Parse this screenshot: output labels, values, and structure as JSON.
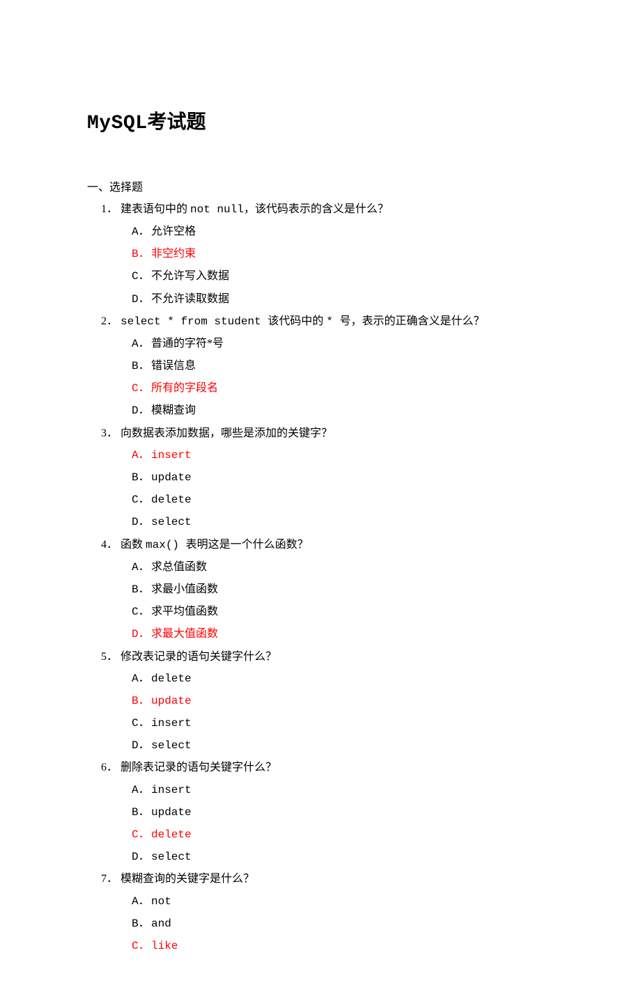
{
  "title_en": "MySQL",
  "title_cn": "考试题",
  "section_header": "一、选择题",
  "questions": [
    {
      "num": "1．",
      "parts": [
        {
          "t": "建表语句中的 ",
          "mono": false
        },
        {
          "t": "not null",
          "mono": true
        },
        {
          "t": "，该代码表示的含义是什么？",
          "mono": false
        }
      ],
      "options": [
        {
          "label": "A．",
          "text": "允许空格",
          "highlight": false,
          "mono": false
        },
        {
          "label": "B．",
          "text": "非空约束",
          "highlight": true,
          "mono": false
        },
        {
          "label": "C．",
          "text": "不允许写入数据",
          "highlight": false,
          "mono": false
        },
        {
          "label": "D．",
          "text": "不允许读取数据",
          "highlight": false,
          "mono": false
        }
      ]
    },
    {
      "num": "2．",
      "parts": [
        {
          "t": "select * from student ",
          "mono": true
        },
        {
          "t": "该代码中的 ",
          "mono": false
        },
        {
          "t": "* ",
          "mono": true
        },
        {
          "t": "号，表示的正确含义是什么？",
          "mono": false
        }
      ],
      "options": [
        {
          "label": "A．",
          "text": "普通的字符*号",
          "highlight": false,
          "mono": false
        },
        {
          "label": "B．",
          "text": "错误信息",
          "highlight": false,
          "mono": false
        },
        {
          "label": "C．",
          "text": "所有的字段名",
          "highlight": true,
          "mono": false
        },
        {
          "label": "D．",
          "text": "模糊查询",
          "highlight": false,
          "mono": false
        }
      ]
    },
    {
      "num": "3．",
      "parts": [
        {
          "t": "向数据表添加数据，哪些是添加的关键字？",
          "mono": false
        }
      ],
      "options": [
        {
          "label": "A．",
          "text": "insert",
          "highlight": true,
          "mono": true
        },
        {
          "label": "B．",
          "text": "update",
          "highlight": false,
          "mono": true
        },
        {
          "label": "C．",
          "text": "delete",
          "highlight": false,
          "mono": true
        },
        {
          "label": "D．",
          "text": "select",
          "highlight": false,
          "mono": true
        }
      ]
    },
    {
      "num": "4．",
      "parts": [
        {
          "t": "函数 ",
          "mono": false
        },
        {
          "t": "max() ",
          "mono": true
        },
        {
          "t": "表明这是一个什么函数？",
          "mono": false
        }
      ],
      "options": [
        {
          "label": "A．",
          "text": "求总值函数",
          "highlight": false,
          "mono": false
        },
        {
          "label": "B．",
          "text": "求最小值函数",
          "highlight": false,
          "mono": false
        },
        {
          "label": "C．",
          "text": "求平均值函数",
          "highlight": false,
          "mono": false
        },
        {
          "label": "D．",
          "text": "求最大值函数",
          "highlight": true,
          "mono": false
        }
      ]
    },
    {
      "num": "5．",
      "parts": [
        {
          "t": "修改表记录的语句关键字什么？",
          "mono": false
        }
      ],
      "options": [
        {
          "label": "A．",
          "text": "delete",
          "highlight": false,
          "mono": true
        },
        {
          "label": "B．",
          "text": "update",
          "highlight": true,
          "mono": true
        },
        {
          "label": "C．",
          "text": "insert",
          "highlight": false,
          "mono": true
        },
        {
          "label": "D．",
          "text": "select",
          "highlight": false,
          "mono": true
        }
      ]
    },
    {
      "num": "6．",
      "parts": [
        {
          "t": "删除表记录的语句关键字什么？",
          "mono": false
        }
      ],
      "options": [
        {
          "label": "A．",
          "text": "insert",
          "highlight": false,
          "mono": true
        },
        {
          "label": "B．",
          "text": "update",
          "highlight": false,
          "mono": true
        },
        {
          "label": "C．",
          "text": "delete",
          "highlight": true,
          "mono": true
        },
        {
          "label": "D．",
          "text": "select",
          "highlight": false,
          "mono": true
        }
      ]
    },
    {
      "num": "7．",
      "parts": [
        {
          "t": "模糊查询的关键字是什么？",
          "mono": false
        }
      ],
      "options": [
        {
          "label": "A．",
          "text": "not",
          "highlight": false,
          "mono": true
        },
        {
          "label": "B．",
          "text": "and",
          "highlight": false,
          "mono": true
        },
        {
          "label": "C．",
          "text": "like",
          "highlight": true,
          "mono": true
        }
      ]
    }
  ]
}
